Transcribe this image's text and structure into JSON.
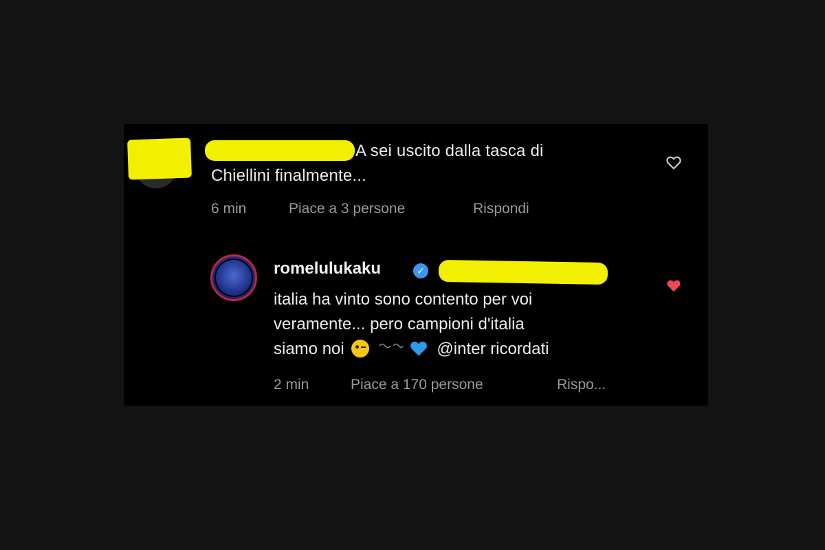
{
  "comment1": {
    "text_line1": "A sei uscito dalla tasca di",
    "text_line2": "Chiellini finalmente...",
    "time": "6 min",
    "likes": "Piace a 3 persone",
    "reply": "Rispondi",
    "liked": false
  },
  "comment2": {
    "username": "romelulukaku",
    "verified": true,
    "line1": "italia ha vinto sono contento per voi",
    "line2": "veramente... pero campioni d'italia",
    "line3_before": "siamo noi",
    "line3_after": "@inter ricordati",
    "time": "2 min",
    "likes": "Piace a 170 persone",
    "reply": "Rispo...",
    "liked": true
  },
  "colors": {
    "page_bg": "#131313",
    "panel_bg": "#000000",
    "redaction": "#f3ef00",
    "like_red": "#ed4956",
    "verified_blue": "#3d97f0",
    "meta_gray": "#9a9a9a"
  },
  "icons": {
    "heart_outline": "heart-outline-icon",
    "heart_filled": "heart-filled-icon",
    "verified": "verified-badge-icon",
    "wink": "winking-face-emoji",
    "blue_heart": "blue-heart-emoji"
  }
}
